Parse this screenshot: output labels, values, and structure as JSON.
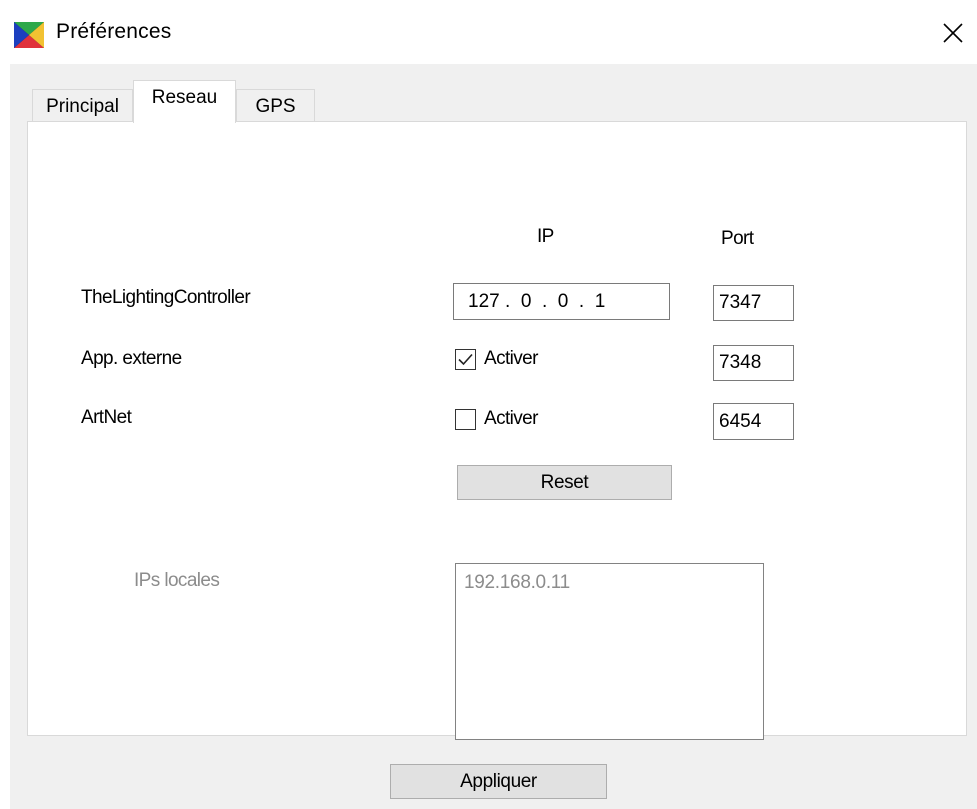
{
  "window": {
    "title": "Préférences",
    "app_icon": "app-logo-icon",
    "close_icon": "close-icon"
  },
  "tabs": [
    {
      "label": "Principal",
      "active": false
    },
    {
      "label": "Reseau",
      "active": true
    },
    {
      "label": "GPS",
      "active": false
    }
  ],
  "network": {
    "col_ip": "IP",
    "col_port": "Port",
    "rows": [
      {
        "label": "TheLightingController",
        "ip": "127 .  0  .  0  .  1",
        "port": "7347"
      },
      {
        "label": "App. externe",
        "checkbox_label": "Activer",
        "checked": true,
        "port": "7348"
      },
      {
        "label": "ArtNet",
        "checkbox_label": "Activer",
        "checked": false,
        "port": "6454"
      }
    ],
    "reset_label": "Reset",
    "local_ips_label": "IPs locales",
    "local_ips": [
      "192.168.0.11"
    ]
  },
  "footer": {
    "apply_label": "Appliquer"
  },
  "colors": {
    "client_bg": "#f0f0f0",
    "panel_bg": "#ffffff",
    "button_bg": "#e1e1e1",
    "disabled_text": "#8c8c8c"
  }
}
